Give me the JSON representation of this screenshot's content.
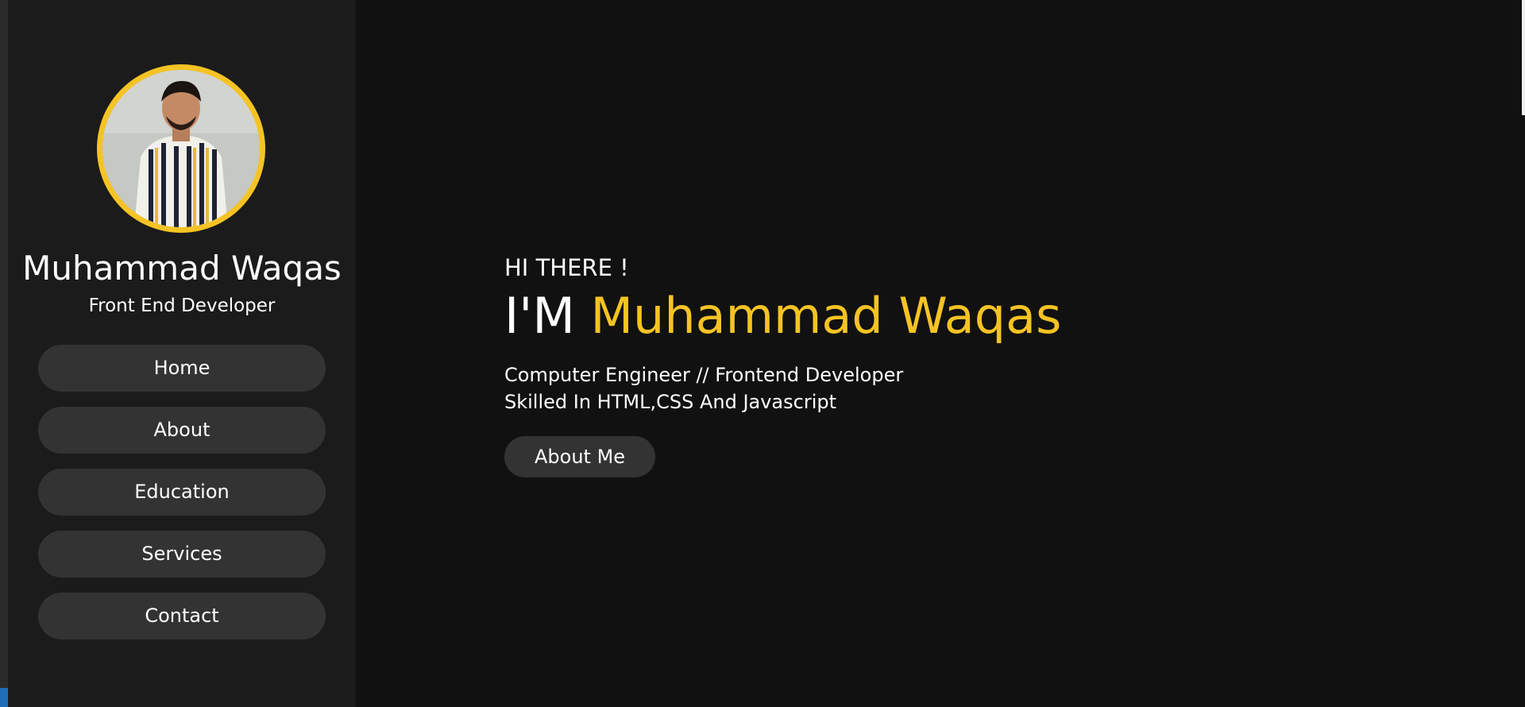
{
  "sidebar": {
    "name": "Muhammad Waqas",
    "role": "Front End Developer",
    "nav": [
      "Home",
      "About",
      "Education",
      "Services",
      "Contact"
    ]
  },
  "hero": {
    "greeting": "HI THERE !",
    "title_prefix": "I'M",
    "title_name": "Muhammad Waqas",
    "line1": "Computer Engineer // Frontend Developer",
    "line2": "Skilled In HTML,CSS And Javascript",
    "button": "About Me"
  },
  "colors": {
    "accent": "#f5c324",
    "background": "#111111",
    "sidebar": "#1b1b1b",
    "button": "#333333"
  }
}
